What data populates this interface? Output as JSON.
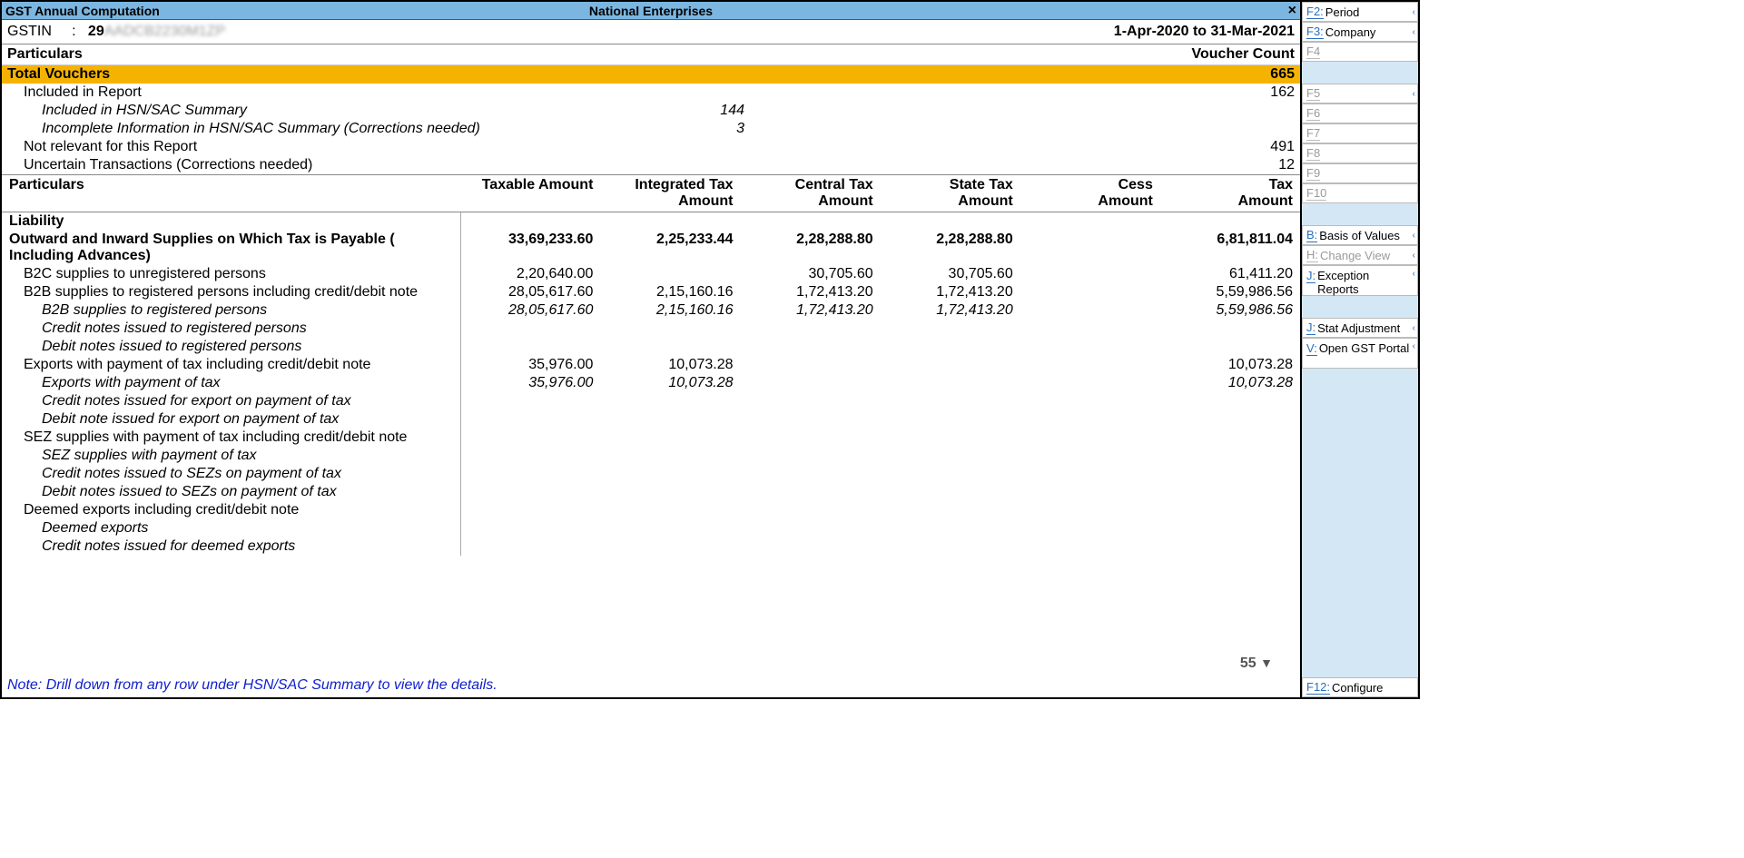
{
  "titlebar": {
    "left": "GST Annual Computation",
    "center": "National Enterprises",
    "close": "×"
  },
  "gstin": {
    "label": "GSTIN",
    "sep": ":",
    "value_prefix": "29",
    "value_blur": "AADCB2230M1ZP",
    "period": "1-Apr-2020 to 31-Mar-2021"
  },
  "vouchers": {
    "header_left": "Particulars",
    "header_right": "Voucher Count",
    "total_label": "Total Vouchers",
    "total_count": "665",
    "rows": [
      {
        "label": "Included in Report",
        "count": "162",
        "indent": 1
      },
      {
        "label": "Included in HSN/SAC Summary",
        "mid": "144",
        "indent": 2
      },
      {
        "label": "Incomplete Information in HSN/SAC Summary (Corrections needed)",
        "mid": "3",
        "indent": 2
      },
      {
        "label": "Not relevant for this Report",
        "count": "491",
        "indent": 1
      },
      {
        "label": "Uncertain Transactions (Corrections needed)",
        "count": "12",
        "indent": 1
      }
    ]
  },
  "columns": {
    "c0": "Particulars",
    "c1a": "Taxable Amount",
    "c1b": "",
    "c2a": "Integrated Tax",
    "c2b": "Amount",
    "c3a": "Central Tax",
    "c3b": "Amount",
    "c4a": "State Tax",
    "c4b": "Amount",
    "c5a": "Cess",
    "c5b": "Amount",
    "c6a": "Tax",
    "c6b": "Amount"
  },
  "liability_section": "Liability",
  "rows": [
    {
      "style": "bold",
      "indent": 0,
      "label": "Outward and Inward Supplies on Which Tax is Payable ( Including Advances)",
      "c1": "33,69,233.60",
      "c2": "2,25,233.44",
      "c3": "2,28,288.80",
      "c4": "2,28,288.80",
      "c5": "",
      "c6": "6,81,811.04"
    },
    {
      "indent": 1,
      "label": "B2C supplies to unregistered persons",
      "c1": "2,20,640.00",
      "c2": "",
      "c3": "30,705.60",
      "c4": "30,705.60",
      "c5": "",
      "c6": "61,411.20"
    },
    {
      "indent": 1,
      "label": "B2B supplies to registered persons including credit/debit note",
      "c1": "28,05,617.60",
      "c2": "2,15,160.16",
      "c3": "1,72,413.20",
      "c4": "1,72,413.20",
      "c5": "",
      "c6": "5,59,986.56"
    },
    {
      "indent": 2,
      "label": "B2B supplies to registered persons",
      "c1": "28,05,617.60",
      "c2": "2,15,160.16",
      "c3": "1,72,413.20",
      "c4": "1,72,413.20",
      "c5": "",
      "c6": "5,59,986.56"
    },
    {
      "indent": 2,
      "label": "Credit notes issued to registered persons"
    },
    {
      "indent": 2,
      "label": "Debit notes issued to registered persons"
    },
    {
      "indent": 1,
      "label": "Exports with payment of tax including credit/debit note",
      "c1": "35,976.00",
      "c2": "10,073.28",
      "c3": "",
      "c4": "",
      "c5": "",
      "c6": "10,073.28"
    },
    {
      "indent": 2,
      "label": "Exports with payment of tax",
      "c1": "35,976.00",
      "c2": "10,073.28",
      "c3": "",
      "c4": "",
      "c5": "",
      "c6": "10,073.28"
    },
    {
      "indent": 2,
      "label": "Credit notes issued for export on payment of tax"
    },
    {
      "indent": 2,
      "label": "Debit note issued for export on payment of tax"
    },
    {
      "indent": 1,
      "label": "SEZ supplies with payment of tax including credit/debit note"
    },
    {
      "indent": 2,
      "label": "SEZ supplies with payment of tax"
    },
    {
      "indent": 2,
      "label": "Credit notes issued to SEZs on payment of tax"
    },
    {
      "indent": 2,
      "label": "Debit notes issued to SEZs on payment of tax"
    },
    {
      "indent": 1,
      "label": "Deemed exports including credit/debit note"
    },
    {
      "indent": 2,
      "label": "Deemed exports"
    },
    {
      "indent": 2,
      "label": "Credit notes issued for deemed exports"
    }
  ],
  "page_num": "55",
  "footer_note": "Note: Drill down from any row under HSN/SAC Summary to view the details.",
  "sidebar": [
    {
      "key": "F2:",
      "label": "Period",
      "active": true,
      "chev": true
    },
    {
      "key": "F3:",
      "label": "Company",
      "active": true,
      "chev": true
    },
    {
      "key": "F4",
      "label": "",
      "active": false
    },
    {
      "spacer": true
    },
    {
      "key": "F5",
      "label": "",
      "active": false,
      "chev": true
    },
    {
      "key": "F6",
      "label": "",
      "active": false
    },
    {
      "key": "F7",
      "label": "",
      "active": false
    },
    {
      "key": "F8",
      "label": "",
      "active": false
    },
    {
      "key": "F9",
      "label": "",
      "active": false
    },
    {
      "key": "F10",
      "label": "",
      "active": false
    },
    {
      "spacer": true
    },
    {
      "key": "B:",
      "label": "Basis of Values",
      "active": true,
      "chev": true
    },
    {
      "key": "H:",
      "label": "Change View",
      "active": false,
      "chev": true
    },
    {
      "key": "J:",
      "label": "Exception Reports",
      "active": true,
      "chev": true,
      "tall": true
    },
    {
      "spacer": true
    },
    {
      "key": "J:",
      "label": "Stat Adjustment",
      "active": true,
      "chev": true
    },
    {
      "key": "V:",
      "label": "Open GST Portal",
      "active": true,
      "chev": true,
      "tall": true
    },
    {
      "flex": true
    },
    {
      "key": "F12:",
      "label": "Configure",
      "active": true
    }
  ]
}
